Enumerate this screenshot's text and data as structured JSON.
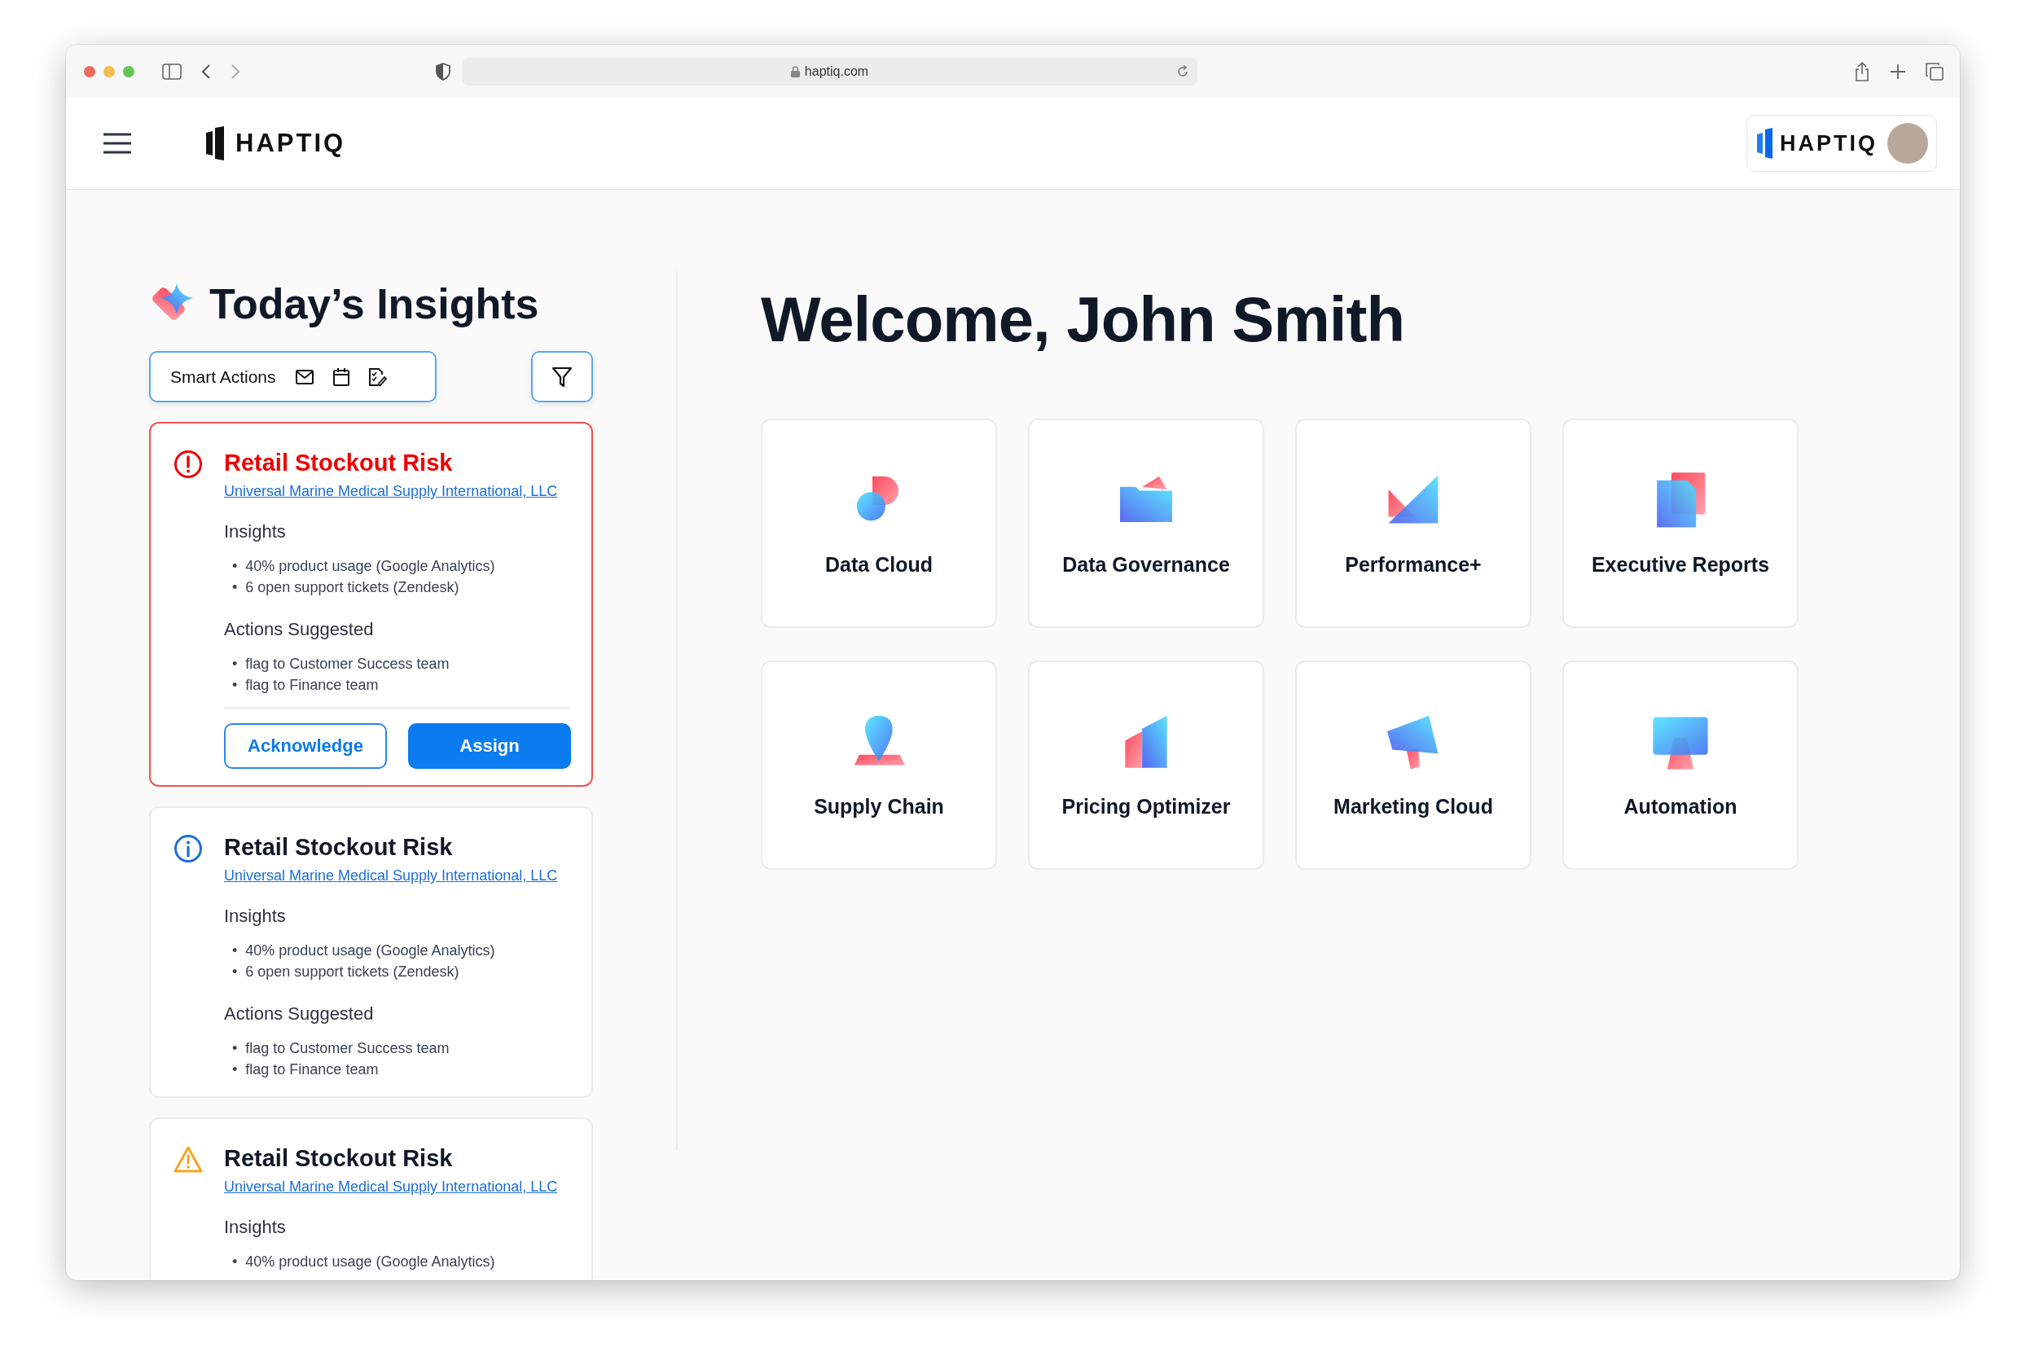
{
  "browser": {
    "url": "haptiq.com"
  },
  "header": {
    "logo": "HAPTIQ",
    "account_logo": "HAPTIQ"
  },
  "insights": {
    "title": "Today’s Insights",
    "smart_actions": {
      "label": "Smart Actions"
    },
    "cards": [
      {
        "kind": "critical",
        "title": "Retail Stockout Risk",
        "company": "Universal Marine Medical Supply International, LLC",
        "sections": [
          {
            "heading": "Insights",
            "items": [
              {
                "marker": "•",
                "text": "40% product usage (Google Analytics)"
              },
              {
                "marker": "•",
                "text": "6 open support tickets (Zendesk)"
              }
            ]
          },
          {
            "heading": "Actions Suggested",
            "items": [
              {
                "marker": "•",
                "text": "flag to Customer Success team"
              },
              {
                "marker": "•",
                "text": "flag to Finance team"
              }
            ]
          }
        ],
        "buttons": [
          {
            "label": "Acknowledge",
            "kind": "secondary"
          },
          {
            "label": "Assign",
            "kind": "primary"
          }
        ]
      },
      {
        "kind": "info",
        "title": "Retail Stockout Risk",
        "company": "Universal Marine Medical Supply International, LLC",
        "sections": [
          {
            "heading": "Insights",
            "items": [
              {
                "marker": "•",
                "text": "40% product usage (Google Analytics)"
              },
              {
                "marker": "•",
                "text": "6 open support tickets (Zendesk)"
              }
            ]
          },
          {
            "heading": "Actions Suggested",
            "items": [
              {
                "marker": "•",
                "text": "flag to Customer Success team"
              },
              {
                "marker": "•",
                "text": "flag to Finance team"
              }
            ]
          }
        ]
      },
      {
        "kind": "warning",
        "title": "Retail Stockout Risk",
        "company": "Universal Marine Medical Supply International, LLC",
        "sections": [
          {
            "heading": "Insights",
            "items": [
              {
                "marker": "•",
                "text": "40% product usage (Google Analytics)"
              }
            ]
          }
        ]
      }
    ]
  },
  "main": {
    "greeting": "Welcome, John Smith",
    "tiles": [
      {
        "label": "Data Cloud"
      },
      {
        "label": "Data Governance"
      },
      {
        "label": "Performance+"
      },
      {
        "label": "Executive Reports"
      },
      {
        "label": "Supply Chain"
      },
      {
        "label": "Pricing Optimizer"
      },
      {
        "label": "Marketing Cloud"
      },
      {
        "label": "Automation"
      }
    ]
  }
}
